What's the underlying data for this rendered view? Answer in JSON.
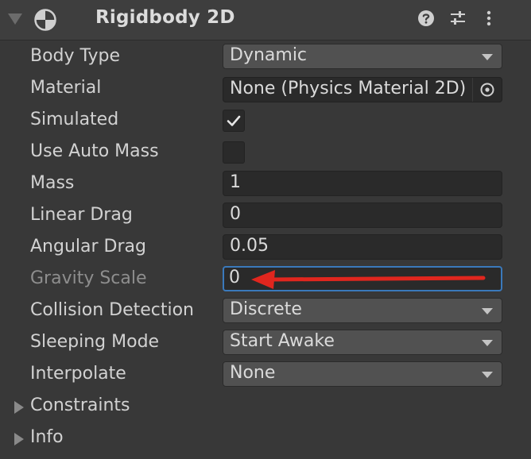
{
  "component": {
    "title": "Rigidbody 2D",
    "icons": [
      "help-icon",
      "presets-sliders-icon",
      "kebab-menu-icon"
    ]
  },
  "properties": {
    "body_type": {
      "label": "Body Type",
      "value": "Dynamic"
    },
    "material": {
      "label": "Material",
      "value": "None (Physics Material 2D)"
    },
    "simulated": {
      "label": "Simulated",
      "checked": true
    },
    "use_auto_mass": {
      "label": "Use Auto Mass",
      "checked": false
    },
    "mass": {
      "label": "Mass",
      "value": "1"
    },
    "linear_drag": {
      "label": "Linear Drag",
      "value": "0"
    },
    "angular_drag": {
      "label": "Angular Drag",
      "value": "0.05"
    },
    "gravity_scale": {
      "label": "Gravity Scale",
      "value": "0"
    },
    "collision_detection": {
      "label": "Collision Detection",
      "value": "Discrete"
    },
    "sleeping_mode": {
      "label": "Sleeping Mode",
      "value": "Start Awake"
    },
    "interpolate": {
      "label": "Interpolate",
      "value": "None"
    }
  },
  "foldouts": {
    "constraints": "Constraints",
    "info": "Info"
  },
  "colors": {
    "background": "#383838",
    "field_focus": "#3a79bb",
    "annotation_arrow": "#e0261e"
  }
}
